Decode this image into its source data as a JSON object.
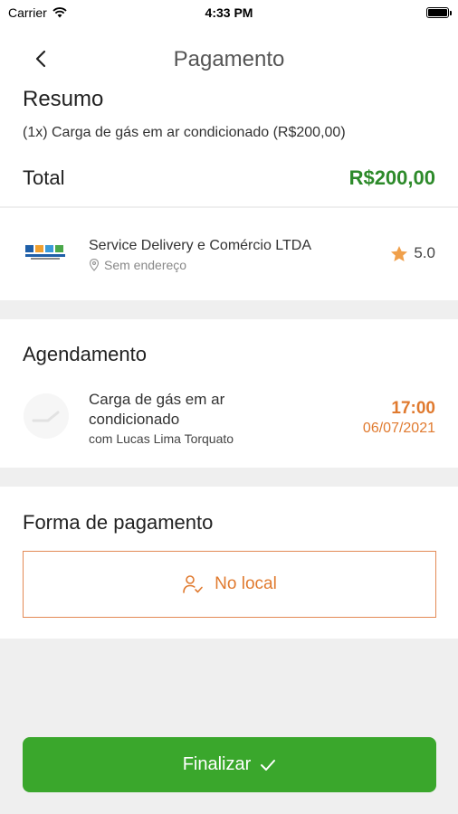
{
  "status_bar": {
    "carrier": "Carrier",
    "time": "4:33 PM"
  },
  "nav": {
    "title": "Pagamento",
    "back_icon": "chevron-left-icon"
  },
  "summary": {
    "heading": "Resumo",
    "item": "(1x)  Carga de gás em ar condicionado (R$200,00)",
    "total_label": "Total",
    "total_value": "R$200,00"
  },
  "company": {
    "name": "Service Delivery e Comércio LTDA",
    "address": "Sem endereço",
    "rating": "5.0"
  },
  "schedule": {
    "heading": "Agendamento",
    "service_name": "Carga de gás em ar condicionado",
    "professional": "com Lucas Lima Torquato",
    "time": "17:00",
    "date": "06/07/2021"
  },
  "payment": {
    "heading": "Forma de pagamento",
    "option_label": "No local"
  },
  "finalize": {
    "label": "Finalizar"
  },
  "colors": {
    "green": "#2d8a2a",
    "button_green": "#3aa72c",
    "orange": "#e07a2f",
    "star": "#f0a04b"
  }
}
